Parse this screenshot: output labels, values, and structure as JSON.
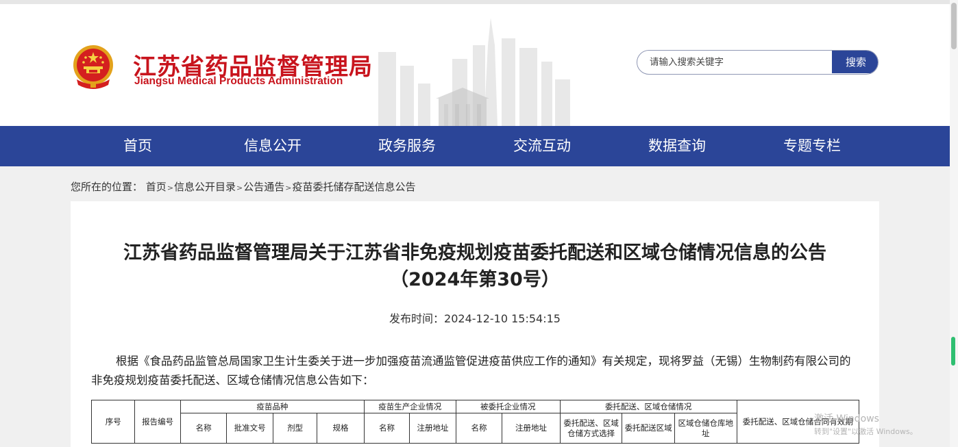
{
  "header": {
    "title": "江苏省药品监督管理局",
    "subtitle": "Jiangsu Medical Products Administration",
    "search": {
      "placeholder": "请输入搜索关键字",
      "button_label": "搜索"
    }
  },
  "nav": {
    "items": [
      {
        "label": "首页"
      },
      {
        "label": "信息公开"
      },
      {
        "label": "政务服务"
      },
      {
        "label": "交流互动"
      },
      {
        "label": "数据查询"
      },
      {
        "label": "专题专栏"
      }
    ]
  },
  "breadcrumb": {
    "prefix": "您所在的位置：",
    "items": [
      "首页",
      "信息公开目录",
      "公告通告",
      "疫苗委托储存配送信息公告"
    ],
    "separator": ">"
  },
  "article": {
    "title": "江苏省药品监督管理局关于江苏省非免疫规划疫苗委托配送和区域仓储情况信息的公告（2024年第30号）",
    "publish_label": "发布时间：",
    "publish_time": "2024-12-10 15:54:15",
    "body": "根据《食品药品监管总局国家卫生计生委关于进一步加强疫苗流通监管促进疫苗供应工作的通知》有关规定，现将罗益（无锡）生物制药有限公司的非免疫规划疫苗委托配送、区域仓储情况信息公告如下："
  },
  "table": {
    "headers": {
      "seq": "序号",
      "report_no": "报告编号",
      "vaccine_group": "疫苗品种",
      "producer_group": "疫苗生产企业情况",
      "entrusted_group": "被委托企业情况",
      "delivery_group": "委托配送、区域仓储情况",
      "validity": "委托配送、区域仓储合同有效期",
      "vaccine_name": "名称",
      "approval_no": "批准文号",
      "dosage_form": "剂型",
      "spec": "规格",
      "producer_name": "名称",
      "producer_address": "注册地址",
      "entrusted_name": "名称",
      "entrusted_address": "注册地址",
      "delivery_method": "委托配送、区域仓储方式选择",
      "delivery_area": "委托配送区域",
      "warehouse_address": "区域仓储仓库地址"
    }
  },
  "overlay": {
    "activation_title": "激活 Windows",
    "activation_sub": "转到\"设置\"以激活 Windows。"
  },
  "colors": {
    "brand_red": "#c8141d",
    "nav_blue": "#2b4598",
    "page_bg": "#f0f0f0"
  }
}
